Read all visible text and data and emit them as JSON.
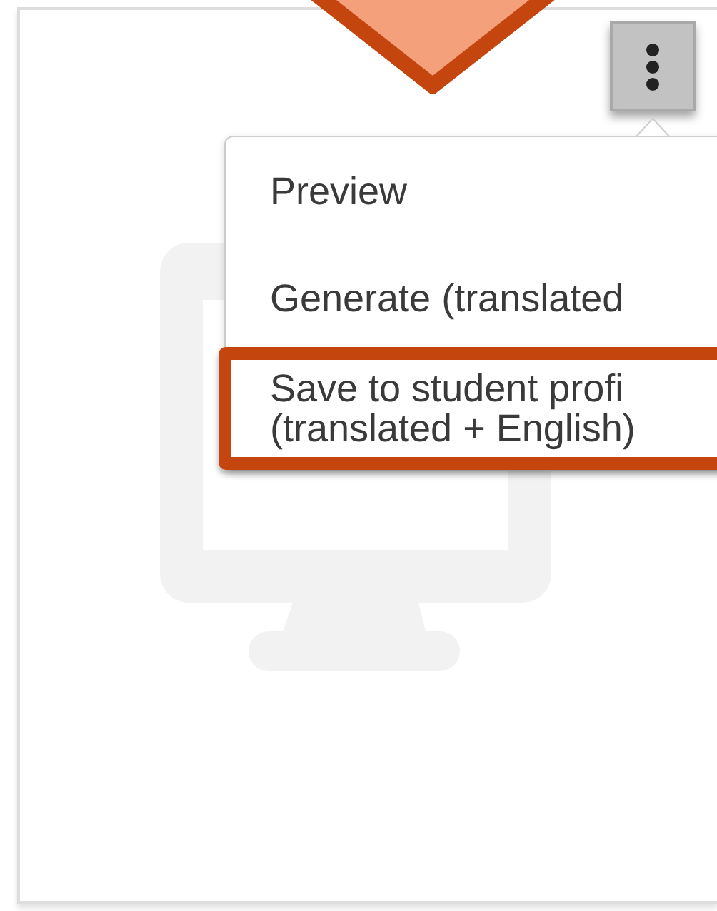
{
  "menu": {
    "items": [
      {
        "label": "Preview",
        "highlighted": false
      },
      {
        "label": "Generate (translated",
        "highlighted": false
      },
      {
        "label": "Save to student profi\n(translated + English)",
        "highlighted": true
      }
    ]
  }
}
